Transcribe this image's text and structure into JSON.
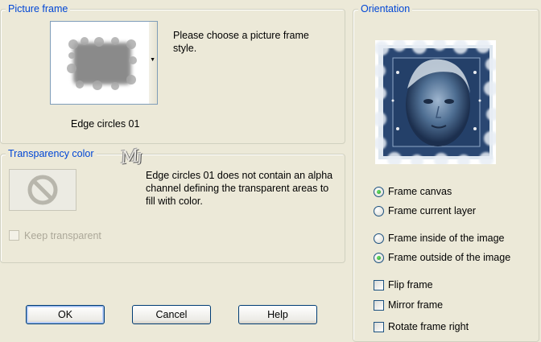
{
  "picture_frame": {
    "title": "Picture frame",
    "instruction": "Please choose a picture frame style.",
    "selected_frame": "Edge circles 01"
  },
  "transparency": {
    "title": "Transparency color",
    "message": "Edge circles 01 does not contain an alpha channel defining the transparent areas to fill with color.",
    "keep_transparent_label": "Keep transparent",
    "keep_transparent_checked": false,
    "keep_transparent_enabled": false
  },
  "orientation": {
    "title": "Orientation",
    "layer_options": [
      {
        "label": "Frame canvas",
        "selected": true
      },
      {
        "label": "Frame current layer",
        "selected": false
      }
    ],
    "position_options": [
      {
        "label": "Frame inside of the image",
        "selected": false
      },
      {
        "label": "Frame outside of the image",
        "selected": true
      }
    ],
    "checkboxes": [
      {
        "label": "Flip frame",
        "checked": false
      },
      {
        "label": "Mirror frame",
        "checked": false
      },
      {
        "label": "Rotate frame right",
        "checked": false
      }
    ]
  },
  "buttons": {
    "ok": "OK",
    "cancel": "Cancel",
    "help": "Help"
  },
  "colors": {
    "dialog_bg": "#ece9d8",
    "group_title": "#0046d5",
    "radio_selected": "#2ea52e"
  },
  "watermark": "MJ"
}
